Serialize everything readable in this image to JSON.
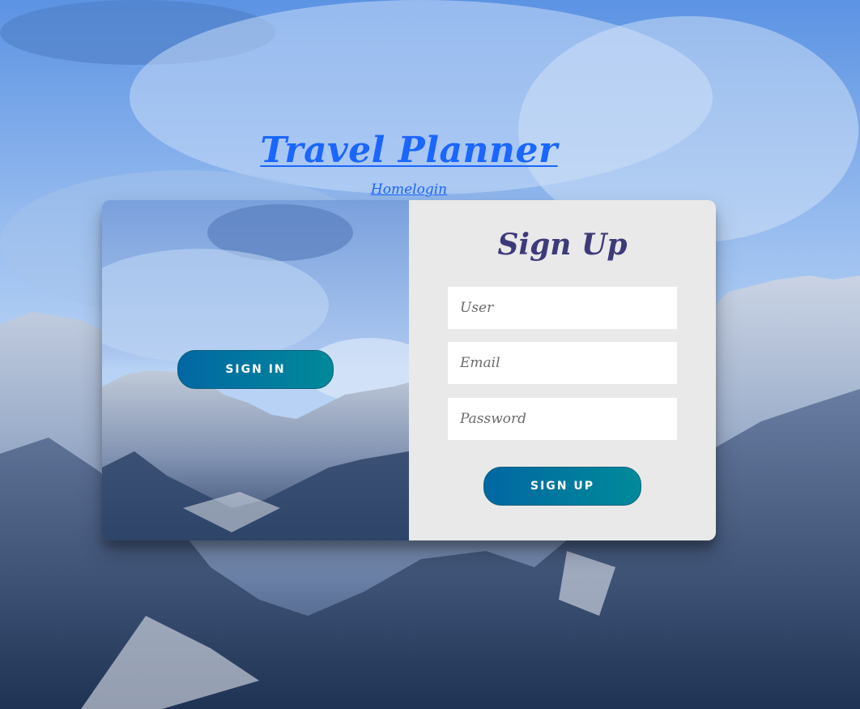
{
  "header": {
    "title": "Travel Planner",
    "nav_link": "Homelogin"
  },
  "overlay_panel": {
    "signin_button": "SIGN IN"
  },
  "signup_form": {
    "title": "Sign Up",
    "user_placeholder": "User",
    "email_placeholder": "Email",
    "password_placeholder": "Password",
    "signup_button": "SIGN UP"
  },
  "colors": {
    "link": "#1a66ff",
    "form_title": "#3d3a7a",
    "button_gradient_start": "#0267a3",
    "button_gradient_end": "#008a9a",
    "form_background": "#e9e9e9"
  }
}
